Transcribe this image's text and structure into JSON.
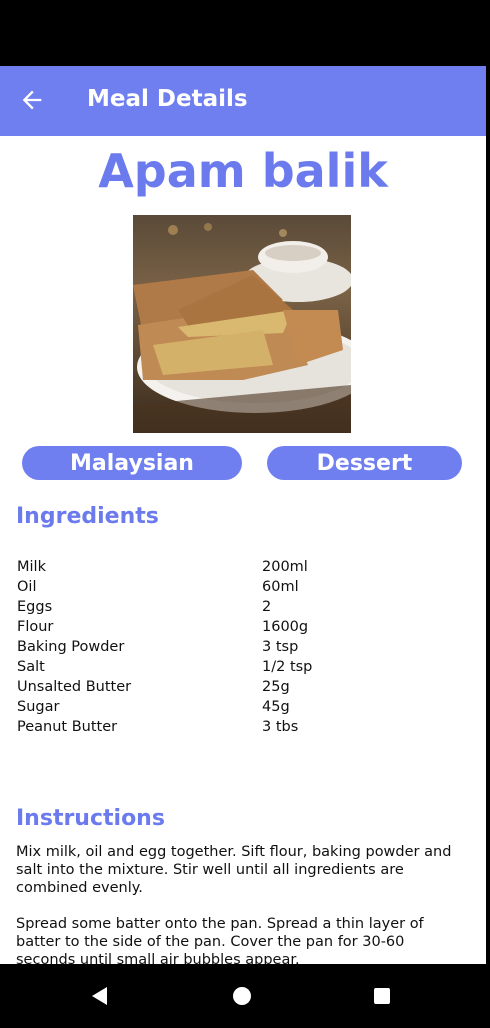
{
  "app_bar": {
    "title": "Meal Details",
    "back_icon": "arrow-left-icon"
  },
  "meal": {
    "name": "Apam balik",
    "area": "Malaysian",
    "category": "Dessert"
  },
  "ingredients": {
    "heading": "Ingredients",
    "items": [
      {
        "name": "Milk",
        "measure": "200ml"
      },
      {
        "name": "Oil",
        "measure": "60ml"
      },
      {
        "name": "Eggs",
        "measure": "2"
      },
      {
        "name": "Flour",
        "measure": "1600g"
      },
      {
        "name": "Baking Powder",
        "measure": "3 tsp"
      },
      {
        "name": "Salt",
        "measure": "1/2 tsp"
      },
      {
        "name": "Unsalted Butter",
        "measure": "25g"
      },
      {
        "name": "Sugar",
        "measure": "45g"
      },
      {
        "name": "Peanut Butter",
        "measure": "3 tbs"
      }
    ]
  },
  "instructions": {
    "heading": "Instructions",
    "paragraphs": [
      "Mix milk, oil and egg together. Sift flour, baking powder and salt into the mixture. Stir well until all ingredients are combined evenly.",
      "Spread some batter onto the pan. Spread a thin layer of batter to the side of the pan. Cover the pan for 30-60 seconds until small air bubbles appear."
    ]
  },
  "nav": {
    "back": "nav-back-icon",
    "home": "nav-home-icon",
    "recents": "nav-recents-icon"
  },
  "colors": {
    "primary": "#6f7ff0",
    "heading": "#6b7bed"
  }
}
